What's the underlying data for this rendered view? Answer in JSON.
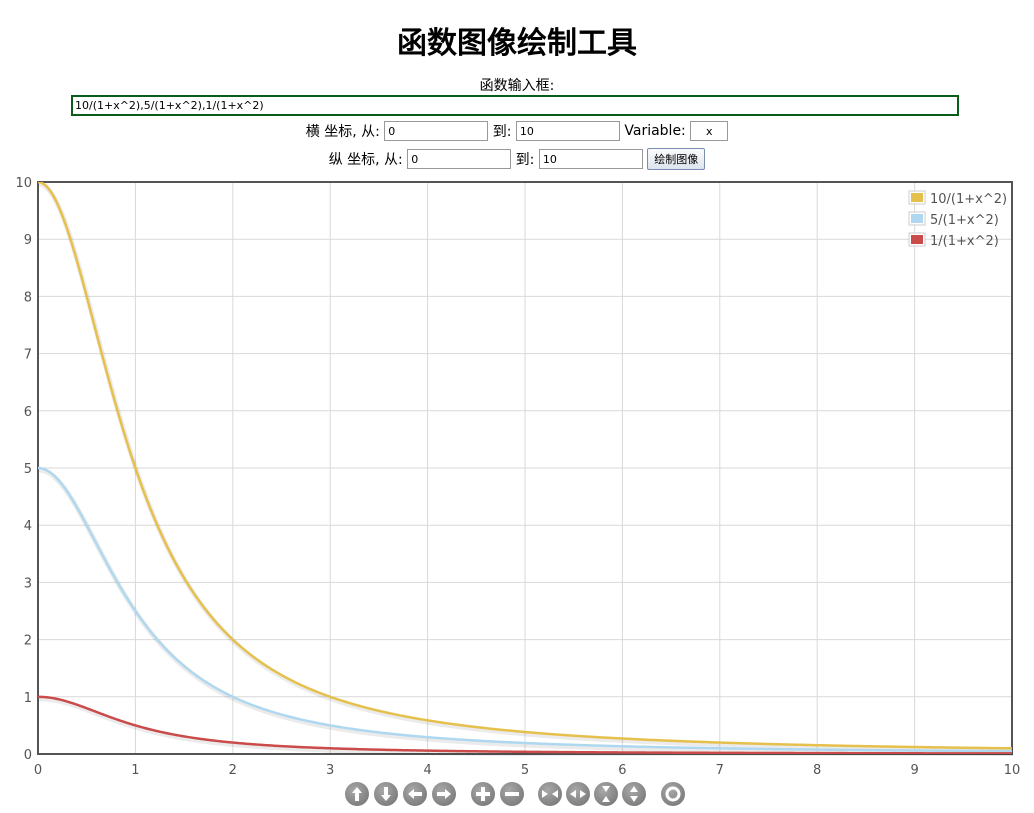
{
  "header": {
    "title": "函数图像绘制工具",
    "input_label": "函数输入框:",
    "function_value": "10/(1+x^2),5/(1+x^2),1/(1+x^2)"
  },
  "x_range": {
    "label": "横 坐标, 从:",
    "from": "0",
    "to_label": "到:",
    "to": "10",
    "variable_label": "Variable:",
    "variable": "x"
  },
  "y_range": {
    "label": "纵 坐标, 从:",
    "from": "0",
    "to_label": "到:",
    "to": "10",
    "draw_button": "绘制图像"
  },
  "chart_data": {
    "type": "line",
    "xlim": [
      0,
      10
    ],
    "ylim": [
      0,
      10
    ],
    "x_ticks": [
      "0",
      "1",
      "2",
      "3",
      "4",
      "5",
      "6",
      "7",
      "8",
      "9",
      "10"
    ],
    "y_ticks": [
      "0",
      "1",
      "2",
      "3",
      "4",
      "5",
      "6",
      "7",
      "8",
      "9",
      "10"
    ],
    "grid": true,
    "legend_position": "top-right",
    "series": [
      {
        "name": "10/(1+x^2)",
        "color": "#e6c04c",
        "coef": 10,
        "x": [
          0,
          0.5,
          1,
          1.5,
          2,
          3,
          4,
          5,
          6,
          7,
          8,
          9,
          10
        ],
        "y": [
          10,
          8,
          5,
          3.08,
          2,
          1,
          0.59,
          0.38,
          0.27,
          0.2,
          0.15,
          0.12,
          0.1
        ]
      },
      {
        "name": "5/(1+x^2)",
        "color": "#afd8f0",
        "coef": 5,
        "x": [
          0,
          0.5,
          1,
          1.5,
          2,
          3,
          4,
          5,
          6,
          7,
          8,
          9,
          10
        ],
        "y": [
          5,
          4,
          2.5,
          1.54,
          1,
          0.5,
          0.29,
          0.19,
          0.14,
          0.1,
          0.08,
          0.06,
          0.05
        ]
      },
      {
        "name": "1/(1+x^2)",
        "color": "#cb4b4b",
        "coef": 1,
        "x": [
          0,
          0.5,
          1,
          1.5,
          2,
          3,
          4,
          5,
          6,
          7,
          8,
          9,
          10
        ],
        "y": [
          1,
          0.8,
          0.5,
          0.31,
          0.2,
          0.1,
          0.06,
          0.04,
          0.03,
          0.02,
          0.02,
          0.01,
          0.01
        ]
      }
    ]
  },
  "navigation": {
    "buttons": [
      "pan-up-icon",
      "pan-down-icon",
      "pan-left-icon",
      "pan-right-icon",
      "zoom-in-icon",
      "zoom-out-icon",
      "shrink-horizontal-icon",
      "expand-horizontal-icon",
      "shrink-vertical-icon",
      "expand-vertical-icon",
      "reset-icon"
    ]
  }
}
